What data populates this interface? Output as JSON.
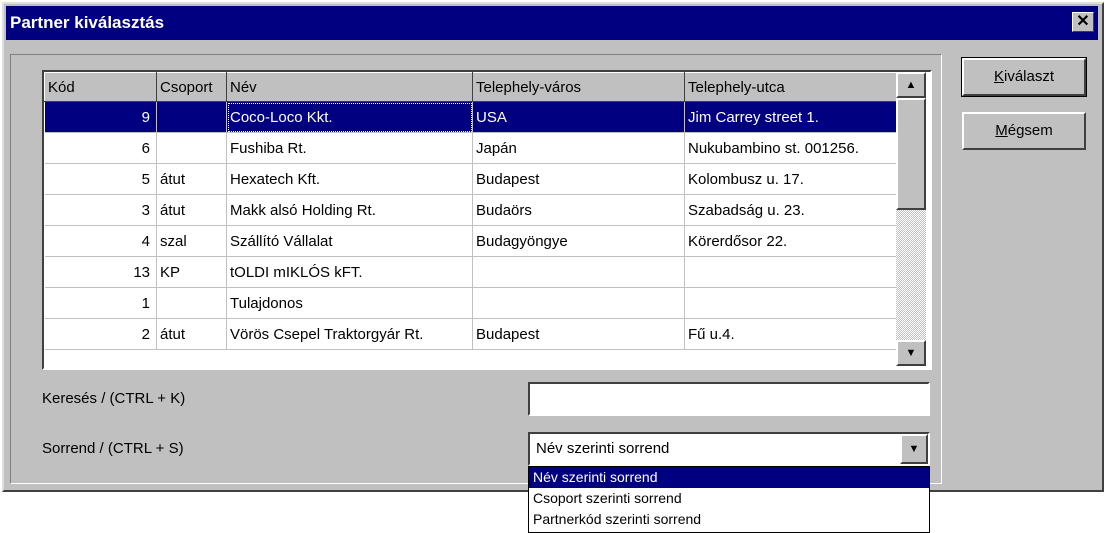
{
  "window": {
    "title": "Partner kiválasztás",
    "close_glyph": "✕"
  },
  "buttons": {
    "select": {
      "underline": "K",
      "rest": "iválaszt"
    },
    "cancel": {
      "underline": "M",
      "rest": "égsem"
    }
  },
  "grid": {
    "columns": [
      "Kód",
      "Csoport",
      "Név",
      "Telephely-város",
      "Telephely-utca"
    ],
    "rows": [
      [
        "9",
        "",
        "Coco-Loco Kkt.",
        "USA",
        "Jim Carrey street 1."
      ],
      [
        "6",
        "",
        "Fushiba Rt.",
        "Japán",
        "Nukubambino st. 001256."
      ],
      [
        "5",
        "átut",
        "Hexatech Kft.",
        "Budapest",
        "Kolombusz u. 17."
      ],
      [
        "3",
        "átut",
        "Makk alsó Holding Rt.",
        "Budaörs",
        "Szabadság u. 23."
      ],
      [
        "4",
        "szal",
        "Szállító Vállalat",
        "Budagyöngye",
        "Körerdősor 22."
      ],
      [
        "13",
        "KP",
        "tOLDI mIKLÓS kFT.",
        "",
        ""
      ],
      [
        "1",
        "",
        "Tulajdonos",
        "",
        ""
      ],
      [
        "2",
        "átut",
        "Vörös Csepel Traktorgyár Rt.",
        "Budapest",
        "Fű u.4."
      ]
    ],
    "selected_row": 0
  },
  "scrollbar": {
    "up_icon": "▲",
    "down_icon": "▼"
  },
  "search": {
    "label": "Keresés / (CTRL + K)",
    "value": ""
  },
  "order": {
    "label": "Sorrend / (CTRL + S)",
    "value": "Név szerinti sorrend",
    "arrow_icon": "▼",
    "options": [
      "Név szerinti sorrend",
      "Csoport szerinti sorrend",
      "Partnerkód szerinti sorrend"
    ],
    "highlighted": 0
  }
}
